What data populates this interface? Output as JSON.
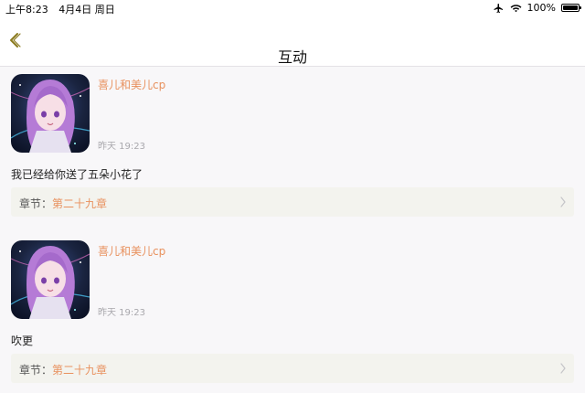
{
  "status_bar": {
    "time": "上午8:23",
    "date": "4月4日 周日",
    "battery_text": "100%",
    "battery_level": 1.0,
    "icons": [
      "airplane-icon",
      "wifi-icon",
      "battery-icon"
    ]
  },
  "nav": {
    "back_icon": "chevron-left-icon",
    "title": "互动"
  },
  "colors": {
    "accent": "#e8915e",
    "back_icon": "#8a7a1e",
    "background": "#f8f7f9",
    "chapter_bg": "#f3f3ee"
  },
  "comments": [
    {
      "username": "喜儿和美儿cp",
      "time": "昨天 19:23",
      "content": "我已经给你送了五朵小花了",
      "chapter_label": "章节：",
      "chapter_name": "第二十九章"
    },
    {
      "username": "喜儿和美儿cp",
      "time": "昨天 19:23",
      "content": "吹更",
      "chapter_label": "章节：",
      "chapter_name": "第二十九章"
    }
  ]
}
